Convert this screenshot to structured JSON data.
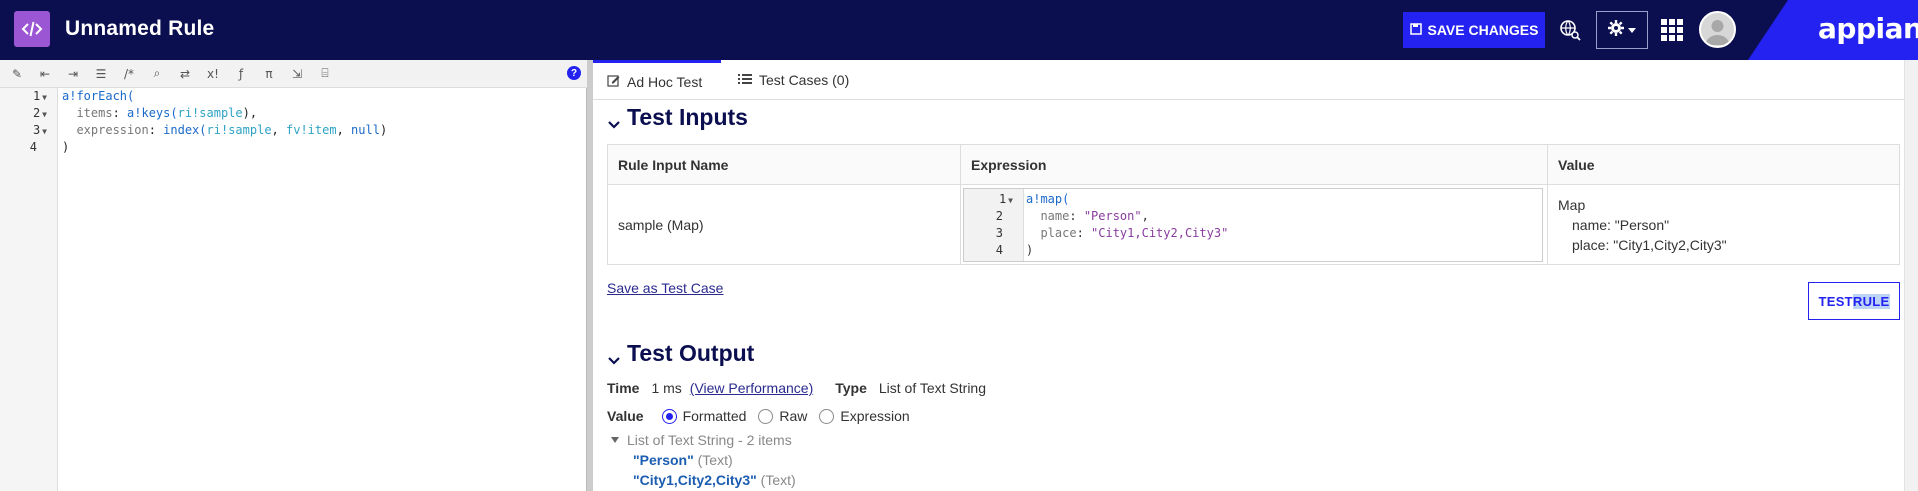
{
  "header": {
    "title": "Unnamed Rule",
    "save_label": "SAVE CHANGES",
    "brand": "appian"
  },
  "editor": {
    "lines": [
      {
        "num": "1",
        "fold": true
      },
      {
        "num": "2",
        "fold": true
      },
      {
        "num": "3",
        "fold": true
      },
      {
        "num": "4",
        "fold": false
      }
    ],
    "code": {
      "l1_fn": "a!forEach(",
      "l2_kw": "items",
      "l2_colon": ": ",
      "l2_fn": "a!keys(",
      "l2_ri": "ri!sample",
      "l2_end": "),",
      "l3_kw": "expression",
      "l3_colon": ": ",
      "l3_fn": "index(",
      "l3_ri": "ri!sample",
      "l3_sep1": ", ",
      "l3_fv": "fv!item",
      "l3_sep2": ", ",
      "l3_null": "null",
      "l3_end": ")",
      "l4": ")"
    },
    "help": "?"
  },
  "tabs": [
    {
      "label": "Ad Hoc Test",
      "icon": "edit-icon",
      "active": true
    },
    {
      "label": "Test Cases (0)",
      "icon": "list-icon",
      "active": false
    }
  ],
  "test_inputs": {
    "heading": "Test Inputs",
    "columns": [
      "Rule Input Name",
      "Expression",
      "Value"
    ],
    "row": {
      "name": "sample (Map)",
      "expr": {
        "l1": "a!map(",
        "l2_key": "name",
        "l2_val": "\"Person\"",
        "l2_end": ",",
        "l3_key": "place",
        "l3_val": "\"City1,City2,City3\"",
        "l4": ")"
      },
      "value_type": "Map",
      "value_lines": [
        "name: \"Person\"",
        "place: \"City1,City2,City3\""
      ]
    },
    "save_case": "Save as Test Case",
    "test_rule": {
      "part1": "TEST ",
      "part2": "RULE"
    }
  },
  "test_output": {
    "heading": "Test Output",
    "time_label": "Time",
    "time_value": "1 ms",
    "perf_link": "(View Performance)",
    "type_label": "Type",
    "type_value": "List of Text String",
    "value_label": "Value",
    "options": [
      {
        "label": "Formatted",
        "selected": true
      },
      {
        "label": "Raw",
        "selected": false
      },
      {
        "label": "Expression",
        "selected": false
      }
    ],
    "list_title": "List of Text String - 2 items",
    "items": [
      {
        "value": "\"Person\"",
        "type": "(Text)"
      },
      {
        "value": "\"City1,City2,City3\"",
        "type": "(Text)"
      }
    ]
  },
  "colors": {
    "header_bg": "#0b0e4f",
    "accent": "#2322f0",
    "logo_bg": "#9b57d3"
  }
}
